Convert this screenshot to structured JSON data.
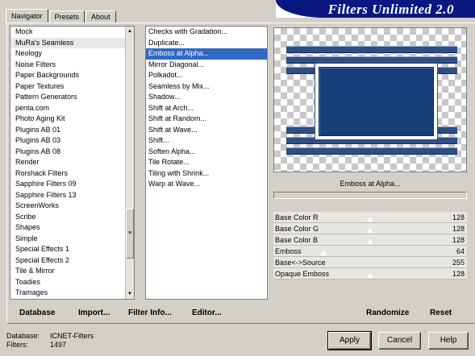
{
  "tabs": [
    "Navigator",
    "Presets",
    "About"
  ],
  "banner_title": "Filters Unlimited 2.0",
  "categories": [
    "Mock",
    "MuRa's Seamless",
    "Neology",
    "Noise Filters",
    "Paper Backgrounds",
    "Paper Textures",
    "Pattern Generators",
    "penta.com",
    "Photo Aging Kit",
    "Plugins AB 01",
    "Plugins AB 03",
    "Plugins AB 08",
    "Render",
    "Rorshack Filters",
    "Sapphire Filters 09",
    "Sapphire Filters 13",
    "ScreenWorks",
    "Scribe",
    "Shapes",
    "Simple",
    "Special Effects 1",
    "Special Effects 2",
    "Tile & Mirror",
    "Toadies",
    "Tramages"
  ],
  "filters": [
    "Checks with Gradation...",
    "Duplicate...",
    "Emboss at Alpha...",
    "Mirror Diagonal...",
    "Polkadot...",
    "Seamless by Mix...",
    "Shadow...",
    "Shift at Arch...",
    "Shift at Random...",
    "Shift at Wave...",
    "Shift...",
    "Soften Alpha...",
    "Tile Rotate...",
    "Tiling with Shrink...",
    "Warp at Wave..."
  ],
  "selected_filter_name": "Emboss at Alpha...",
  "controls": [
    {
      "label": "Base Color R",
      "value": "128"
    },
    {
      "label": "Base Color G",
      "value": "128"
    },
    {
      "label": "Base Color B",
      "value": "128"
    },
    {
      "label": "Emboss",
      "value": "64"
    },
    {
      "label": "Base<->Source",
      "value": "255"
    },
    {
      "label": "Opaque Emboss",
      "value": "128"
    }
  ],
  "bottom_left": {
    "database": "Database",
    "import": "Import...",
    "filter_info": "Filter Info...",
    "editor": "Editor..."
  },
  "bottom_right": {
    "randomize": "Randomize",
    "reset": "Reset"
  },
  "footer": {
    "database_label": "Database:",
    "database_value": "ICNET-Filters",
    "filters_label": "Filters:",
    "filters_value": "1497"
  },
  "buttons": {
    "apply": "Apply",
    "cancel": "Cancel",
    "help": "Help"
  }
}
